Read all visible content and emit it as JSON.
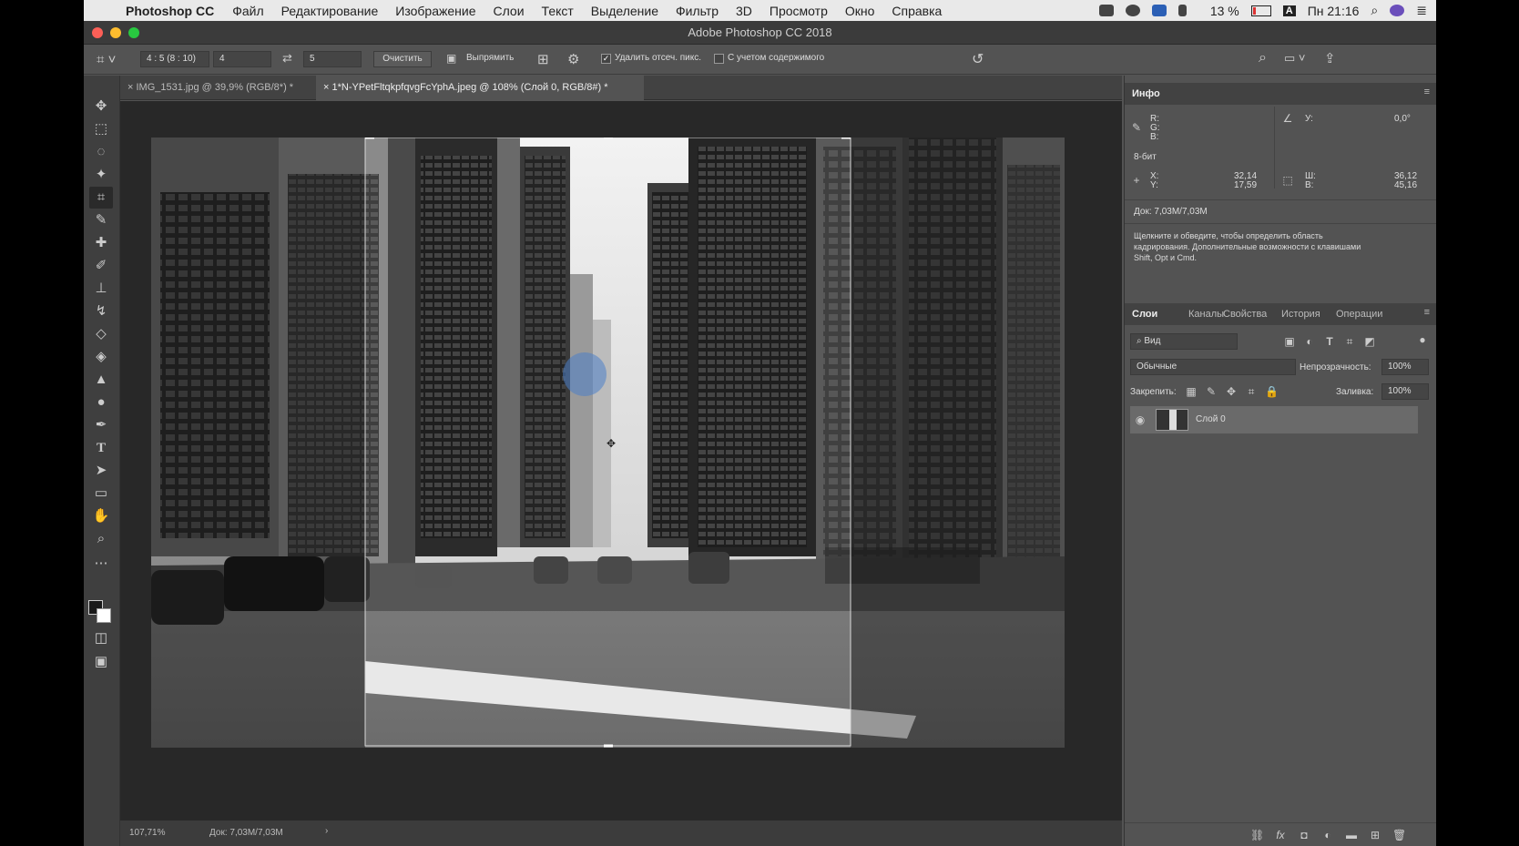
{
  "menubar": {
    "app_name": "Photoshop CC",
    "items": [
      "Файл",
      "Редактирование",
      "Изображение",
      "Слои",
      "Текст",
      "Выделение",
      "Фильтр",
      "3D",
      "Просмотр",
      "Окно",
      "Справка"
    ],
    "battery": "13 %",
    "input_source": "A",
    "clock": "Пн 21:16"
  },
  "window": {
    "title": "Adobe Photoshop CC 2018"
  },
  "options": {
    "ratio_preset": "4 : 5 (8 : 10)",
    "width_value": "4",
    "height_value": "5",
    "clear_label": "Очистить",
    "straighten_label": "Выпрямить",
    "delete_cropped_label": "Удалить отсеч. пикс.",
    "content_aware_label": "С учетом содержимого"
  },
  "tabs": [
    {
      "label": "IMG_1531.jpg @ 39,9% (RGB/8*) *",
      "active": false
    },
    {
      "label": "1*N-YPetFltqkpfqvgFcYphA.jpeg @ 108% (Слой 0, RGB/8#) *",
      "active": true
    }
  ],
  "status": {
    "zoom": "107,71%",
    "doc": "Док: 7,03M/7,03M"
  },
  "info_panel": {
    "title": "Инфо",
    "r": "R:",
    "g": "G:",
    "b": "B:",
    "bit_depth": "8-бит",
    "angle_label": "У:",
    "angle_value": "0,0°",
    "x_label": "X:",
    "x_value": "32,14",
    "y_label": "Y:",
    "y_value": "17,59",
    "w_label": "Ш:",
    "w_value": "36,12",
    "h_label": "В:",
    "h_value": "45,16",
    "doc": "Док: 7,03M/7,03M",
    "hint_line1": "Щелкните и обведите, чтобы определить область",
    "hint_line2": "кадрирования. Дополнительные возможности с клавишами",
    "hint_line3": "Shift, Opt и Cmd."
  },
  "layers_panel": {
    "tabs": [
      "Слои",
      "Каналы",
      "Свойства",
      "История",
      "Операции"
    ],
    "filter_kind": "Вид",
    "blend_mode": "Обычные",
    "opacity_label": "Непрозрачность:",
    "opacity_value": "100%",
    "lock_label": "Закрепить:",
    "fill_label": "Заливка:",
    "fill_value": "100%",
    "layer_name": "Слой 0"
  },
  "colors": {
    "ui_bg": "#535353",
    "panel_dark": "#424242",
    "canvas_bg": "#282828",
    "selection": "#6a6a6a"
  }
}
